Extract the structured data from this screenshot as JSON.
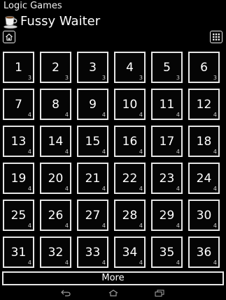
{
  "app": {
    "title": "Logic Games",
    "game_title": "Fussy Waiter"
  },
  "icons": {
    "cup": "coffee-cup-icon",
    "home": "home-icon",
    "grid_menu": "grid-menu-icon"
  },
  "levels": [
    {
      "number": "1",
      "badge": "3"
    },
    {
      "number": "2",
      "badge": "3"
    },
    {
      "number": "3",
      "badge": "3"
    },
    {
      "number": "4",
      "badge": "3"
    },
    {
      "number": "5",
      "badge": "3"
    },
    {
      "number": "6",
      "badge": "3"
    },
    {
      "number": "7",
      "badge": "4"
    },
    {
      "number": "8",
      "badge": "4"
    },
    {
      "number": "9",
      "badge": "4"
    },
    {
      "number": "10",
      "badge": "4"
    },
    {
      "number": "11",
      "badge": "4"
    },
    {
      "number": "12",
      "badge": "4"
    },
    {
      "number": "13",
      "badge": "4"
    },
    {
      "number": "14",
      "badge": "4"
    },
    {
      "number": "15",
      "badge": "4"
    },
    {
      "number": "16",
      "badge": "4"
    },
    {
      "number": "17",
      "badge": "4"
    },
    {
      "number": "18",
      "badge": "4"
    },
    {
      "number": "19",
      "badge": "4"
    },
    {
      "number": "20",
      "badge": "4"
    },
    {
      "number": "21",
      "badge": "4"
    },
    {
      "number": "22",
      "badge": "4"
    },
    {
      "number": "23",
      "badge": "4"
    },
    {
      "number": "24",
      "badge": "4"
    },
    {
      "number": "25",
      "badge": "4"
    },
    {
      "number": "26",
      "badge": "4"
    },
    {
      "number": "27",
      "badge": "4"
    },
    {
      "number": "28",
      "badge": "4"
    },
    {
      "number": "29",
      "badge": "4"
    },
    {
      "number": "30",
      "badge": "4"
    },
    {
      "number": "31",
      "badge": "4"
    },
    {
      "number": "32",
      "badge": "4"
    },
    {
      "number": "33",
      "badge": "4"
    },
    {
      "number": "34",
      "badge": "4"
    },
    {
      "number": "35",
      "badge": "4"
    },
    {
      "number": "36",
      "badge": "4"
    }
  ],
  "more_label": "More",
  "nav": {
    "back": "back-icon",
    "home": "nav-home-icon",
    "recent": "recent-apps-icon"
  },
  "colors": {
    "background": "#000000",
    "border": "#e6e6e6",
    "text": "#ffffff"
  }
}
